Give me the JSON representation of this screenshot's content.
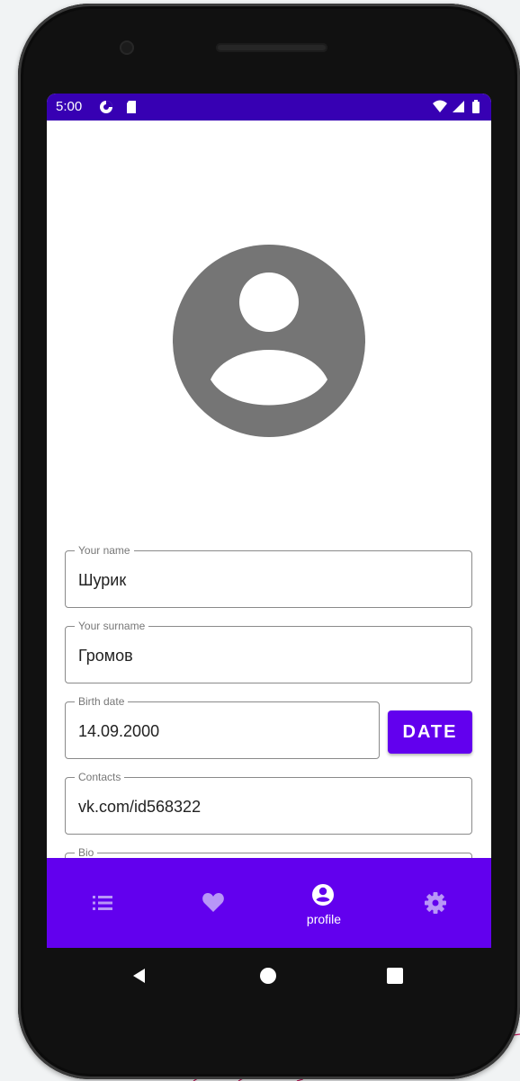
{
  "statusbar": {
    "time": "5:00",
    "icons": [
      "data-saver-icon",
      "sd-card-icon",
      "wifi-icon",
      "signal-icon",
      "battery-icon"
    ]
  },
  "profile": {
    "avatar_icon": "account-circle-icon",
    "fields": [
      {
        "label": "Your name",
        "value": "Шурик"
      },
      {
        "label": "Your surname",
        "value": "Громов"
      },
      {
        "label": "Birth date",
        "value": "14.09.2000"
      },
      {
        "label": "Contacts",
        "value": "vk.com/id568322"
      },
      {
        "label": "Bio",
        "value": ""
      }
    ],
    "date_button": "DATE"
  },
  "bottom_nav": {
    "items": [
      {
        "icon": "list-icon",
        "label": "",
        "selected": false
      },
      {
        "icon": "heart-icon",
        "label": "",
        "selected": false
      },
      {
        "icon": "account-circle-icon",
        "label": "profile",
        "selected": true
      },
      {
        "icon": "gear-icon",
        "label": "",
        "selected": false
      }
    ]
  },
  "system_nav": {
    "icons": [
      "back-icon",
      "home-icon",
      "recents-icon"
    ]
  },
  "colors": {
    "status_bar": "#3700b3",
    "primary": "#6200ee",
    "nav_icon_inactive": "#b896f7",
    "avatar": "#757575",
    "field_border": "#8a8a8a"
  }
}
